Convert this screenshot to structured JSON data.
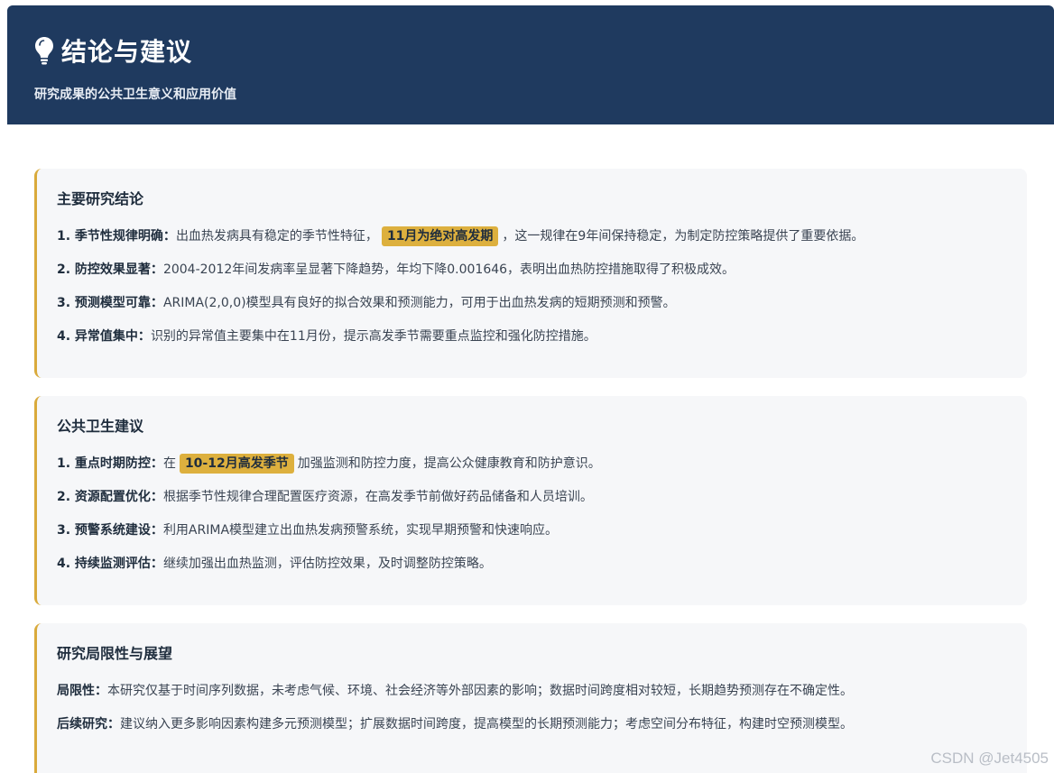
{
  "header": {
    "icon": "lightbulb-icon",
    "title": "结论与建议",
    "subtitle": "研究成果的公共卫生意义和应用价值"
  },
  "sections": [
    {
      "title": "主要研究结论",
      "items": [
        {
          "label": "1. 季节性规律明确：",
          "pre": "出血热发病具有稳定的季节性特征，",
          "highlight": "11月为绝对高发期",
          "post": "，这一规律在9年间保持稳定，为制定防控策略提供了重要依据。"
        },
        {
          "label": "2. 防控效果显著：",
          "pre": "2004-2012年间发病率呈显著下降趋势，年均下降0.001646，表明出血热防控措施取得了积极成效。"
        },
        {
          "label": "3. 预测模型可靠：",
          "pre": "ARIMA(2,0,0)模型具有良好的拟合效果和预测能力，可用于出血热发病的短期预测和预警。"
        },
        {
          "label": "4. 异常值集中：",
          "pre": "识别的异常值主要集中在11月份，提示高发季节需要重点监控和强化防控措施。"
        }
      ]
    },
    {
      "title": "公共卫生建议",
      "items": [
        {
          "label": "1. 重点时期防控：",
          "pre": "在",
          "highlight": "10-12月高发季节",
          "post": "加强监测和防控力度，提高公众健康教育和防护意识。"
        },
        {
          "label": "2. 资源配置优化：",
          "pre": "根据季节性规律合理配置医疗资源，在高发季节前做好药品储备和人员培训。"
        },
        {
          "label": "3. 预警系统建设：",
          "pre": "利用ARIMA模型建立出血热发病预警系统，实现早期预警和快速响应。"
        },
        {
          "label": "4. 持续监测评估：",
          "pre": "继续加强出血热监测，评估防控效果，及时调整防控策略。"
        }
      ]
    },
    {
      "title": "研究局限性与展望",
      "items": [
        {
          "label": "局限性：",
          "pre": "本研究仅基于时间序列数据，未考虑气候、环境、社会经济等外部因素的影响；数据时间跨度相对较短，长期趋势预测存在不确定性。"
        },
        {
          "label": "后续研究：",
          "pre": "建议纳入更多影响因素构建多元预测模型；扩展数据时间跨度，提高模型的长期预测能力；考虑空间分布特征，构建时空预测模型。"
        }
      ]
    }
  ],
  "watermark": "CSDN @Jet4505",
  "colors": {
    "header_bg": "#1f3a5f",
    "accent": "#d9aa3b",
    "card_bg": "#f6f7f9"
  }
}
